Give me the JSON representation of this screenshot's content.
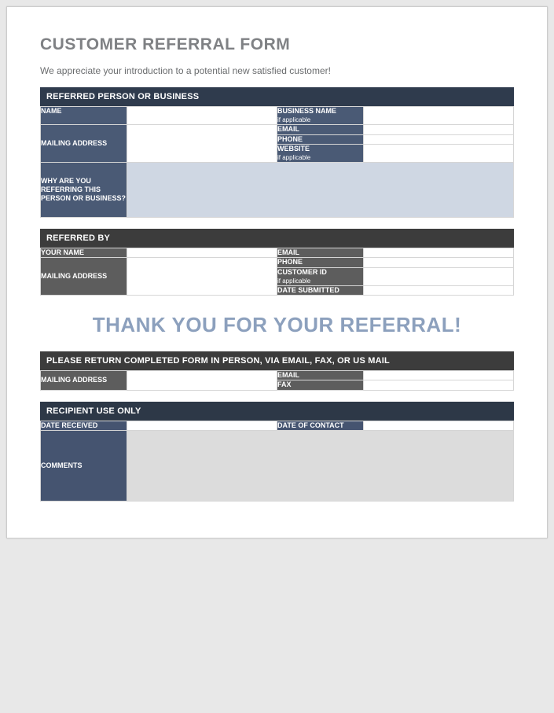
{
  "title": "CUSTOMER REFERRAL FORM",
  "intro": "We appreciate your introduction to a potential new satisfied customer!",
  "sections": {
    "referred": {
      "header": "REFERRED PERSON OR BUSINESS",
      "labels": {
        "name": "NAME",
        "mailing": "MAILING ADDRESS",
        "business": "BUSINESS NAME",
        "business_sub": "if applicable",
        "email": "EMAIL",
        "phone": "PHONE",
        "website": "WEBSITE",
        "website_sub": "if applicable",
        "why": "WHY ARE YOU REFERRING THIS PERSON OR BUSINESS?"
      }
    },
    "referred_by": {
      "header": "REFERRED BY",
      "labels": {
        "your_name": "YOUR NAME",
        "mailing": "MAILING ADDRESS",
        "email": "EMAIL",
        "phone": "PHONE",
        "customer_id": "CUSTOMER ID",
        "customer_id_sub": "if applicable",
        "date_submitted": "DATE SUBMITTED"
      }
    },
    "thank_you": "THANK YOU FOR YOUR REFERRAL!",
    "return_form": {
      "header": "PLEASE RETURN COMPLETED FORM IN PERSON, VIA EMAIL, FAX, OR US MAIL",
      "labels": {
        "mailing": "MAILING ADDRESS",
        "email": "EMAIL",
        "fax": "FAX"
      }
    },
    "recipient": {
      "header": "RECIPIENT USE ONLY",
      "labels": {
        "date_received": "DATE RECEIVED",
        "date_contact": "DATE OF CONTACT",
        "comments": "COMMENTS"
      }
    }
  }
}
